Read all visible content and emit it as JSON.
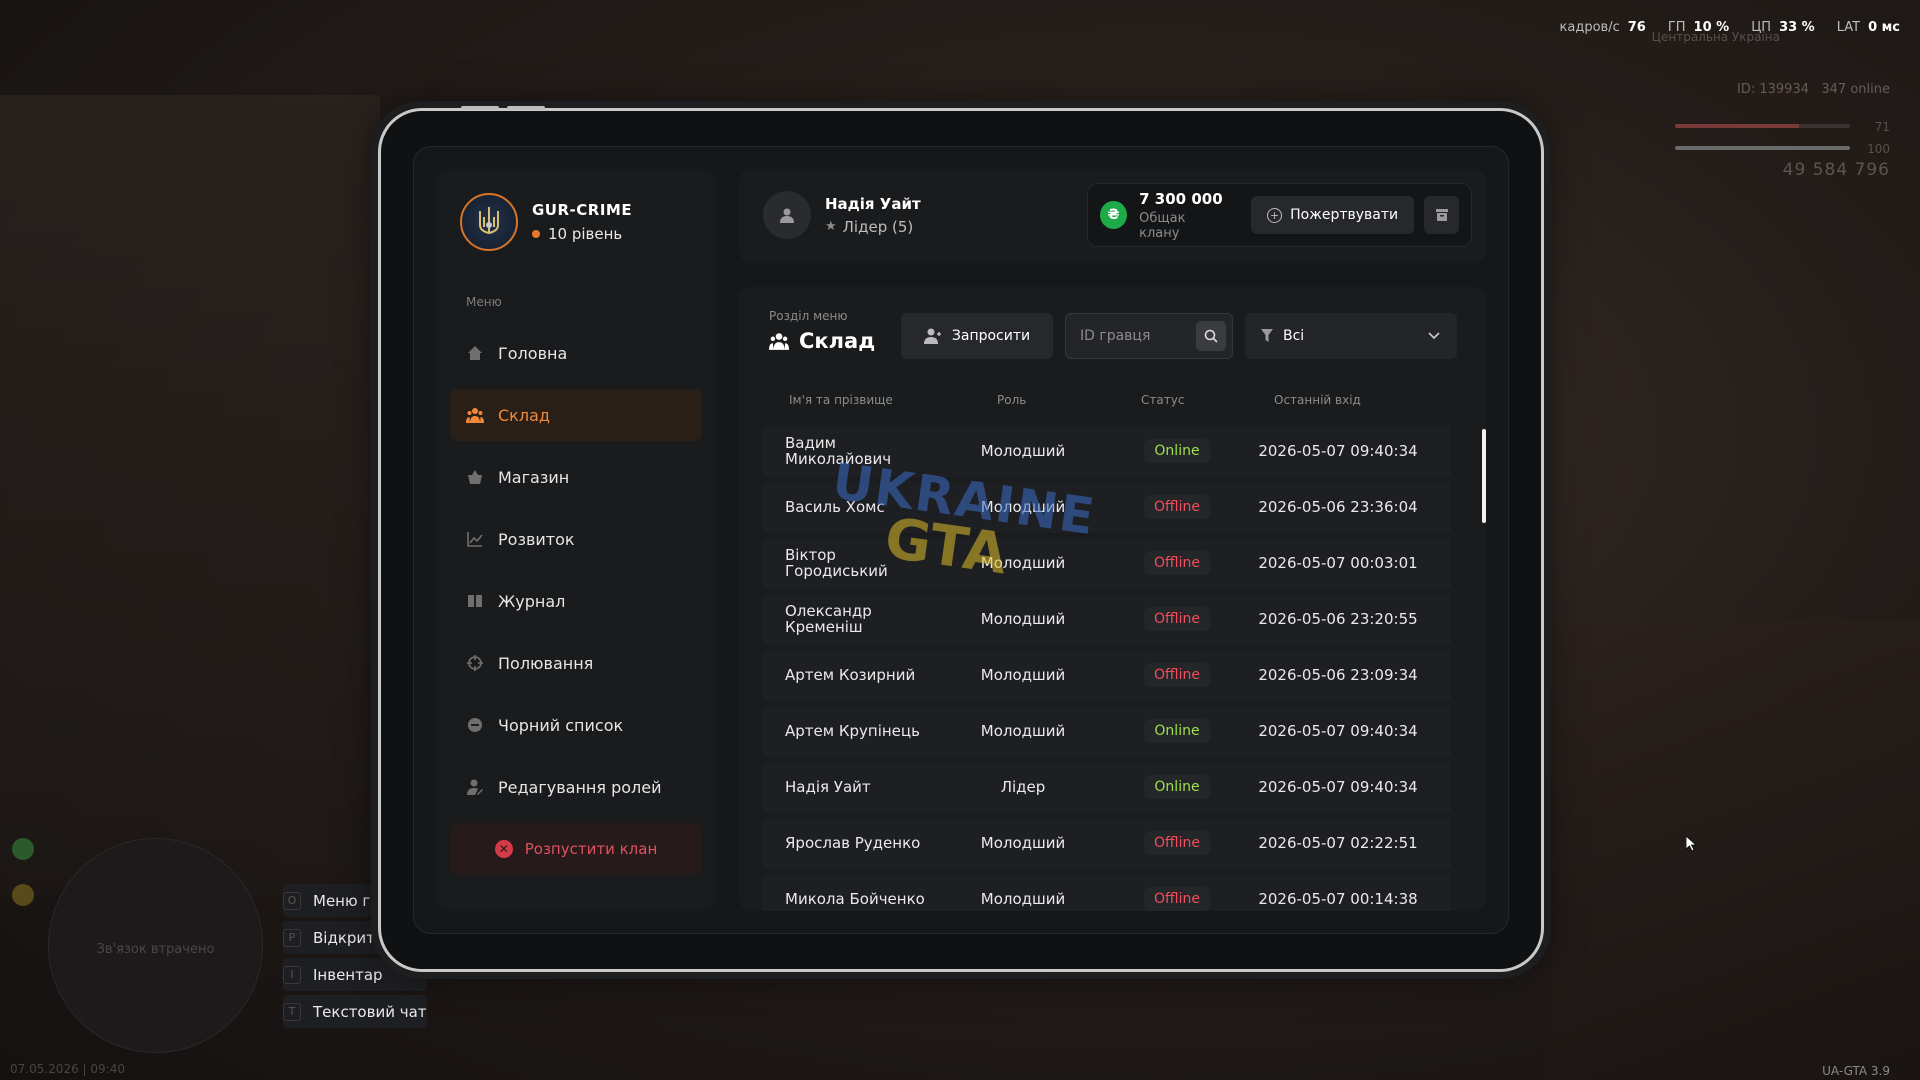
{
  "hud": {
    "fps_label": "кадров/с",
    "fps": "76",
    "gpu_label": "ГП",
    "gpu": "10 %",
    "cpu_label": "ЦП",
    "cpu": "33 %",
    "lat_label": "LAT",
    "lat": "0 мс",
    "region": "Центральна Україна",
    "player_id": "ID: 139934",
    "online": "347 online",
    "health_value": "71",
    "health_fraction": 0.71,
    "armor_value": "100",
    "armor_fraction": 1.0,
    "money": "49 584 796",
    "minimap_text": "Зв'язок втрачено",
    "datetime": "07.05.2026 | 09:40",
    "version": "UA-GTA 3.9",
    "hints": [
      {
        "key": "O",
        "label": "Меню гра..."
      },
      {
        "key": "P",
        "label": "Відкрити..."
      },
      {
        "key": "I",
        "label": "Інвентар"
      },
      {
        "key": "T",
        "label": "Текстовий чат"
      }
    ]
  },
  "clan": {
    "name": "GUR-CRIME",
    "level": "10 рівень"
  },
  "menu": {
    "label": "Меню",
    "items": [
      {
        "label": "Головна",
        "icon": "home-icon",
        "active": false
      },
      {
        "label": "Склад",
        "icon": "people-icon",
        "active": true
      },
      {
        "label": "Магазин",
        "icon": "basket-icon",
        "active": false
      },
      {
        "label": "Розвиток",
        "icon": "chart-icon",
        "active": false
      },
      {
        "label": "Журнал",
        "icon": "book-icon",
        "active": false
      },
      {
        "label": "Полювання",
        "icon": "crosshair-icon",
        "active": false
      },
      {
        "label": "Чорний список",
        "icon": "block-icon",
        "active": false
      },
      {
        "label": "Редагування ролей",
        "icon": "user-edit-icon",
        "active": false
      }
    ],
    "disband_label": "Розпустити клан"
  },
  "user": {
    "name": "Надія Уайт",
    "role": "Лідер (5)"
  },
  "fund": {
    "amount": "7 300 000",
    "label": "Общак клану",
    "donate_label": "Пожертвувати"
  },
  "section": {
    "sub": "Розділ меню",
    "title": "Склад",
    "invite_label": "Запросити",
    "search_placeholder": "ID гравця",
    "filter_value": "Всі"
  },
  "table": {
    "headers": [
      "Ім'я та прізвище",
      "Роль",
      "Статус",
      "Останній вхід"
    ],
    "rows": [
      {
        "name": "Вадим Миколайович",
        "role": "Молодший",
        "status": "Online",
        "last": "2026-05-07 09:40:34"
      },
      {
        "name": "Василь Хомс",
        "role": "Молодший",
        "status": "Offline",
        "last": "2026-05-06 23:36:04"
      },
      {
        "name": "Віктор Городиський",
        "role": "Молодший",
        "status": "Offline",
        "last": "2026-05-07 00:03:01"
      },
      {
        "name": "Олександр Кременіш",
        "role": "Молодший",
        "status": "Offline",
        "last": "2026-05-06 23:20:55"
      },
      {
        "name": "Артем Козирний",
        "role": "Молодший",
        "status": "Offline",
        "last": "2026-05-06 23:09:34"
      },
      {
        "name": "Артем Крупінець",
        "role": "Молодший",
        "status": "Online",
        "last": "2026-05-07 09:40:34"
      },
      {
        "name": "Надія Уайт",
        "role": "Лідер",
        "status": "Online",
        "last": "2026-05-07 09:40:34"
      },
      {
        "name": "Ярослав Руденко",
        "role": "Молодший",
        "status": "Offline",
        "last": "2026-05-07 02:22:51"
      },
      {
        "name": "Микола Бойченко",
        "role": "Молодший",
        "status": "Offline",
        "last": "2026-05-07 00:14:38"
      }
    ]
  },
  "watermark": {
    "line1": "UKRAINE",
    "line2": "GTA"
  },
  "colors": {
    "accent": "#f08a3a",
    "online": "#9fe04a",
    "offline": "#ef4d5a",
    "danger": "#e0525e",
    "coin": "#1faa4a"
  }
}
